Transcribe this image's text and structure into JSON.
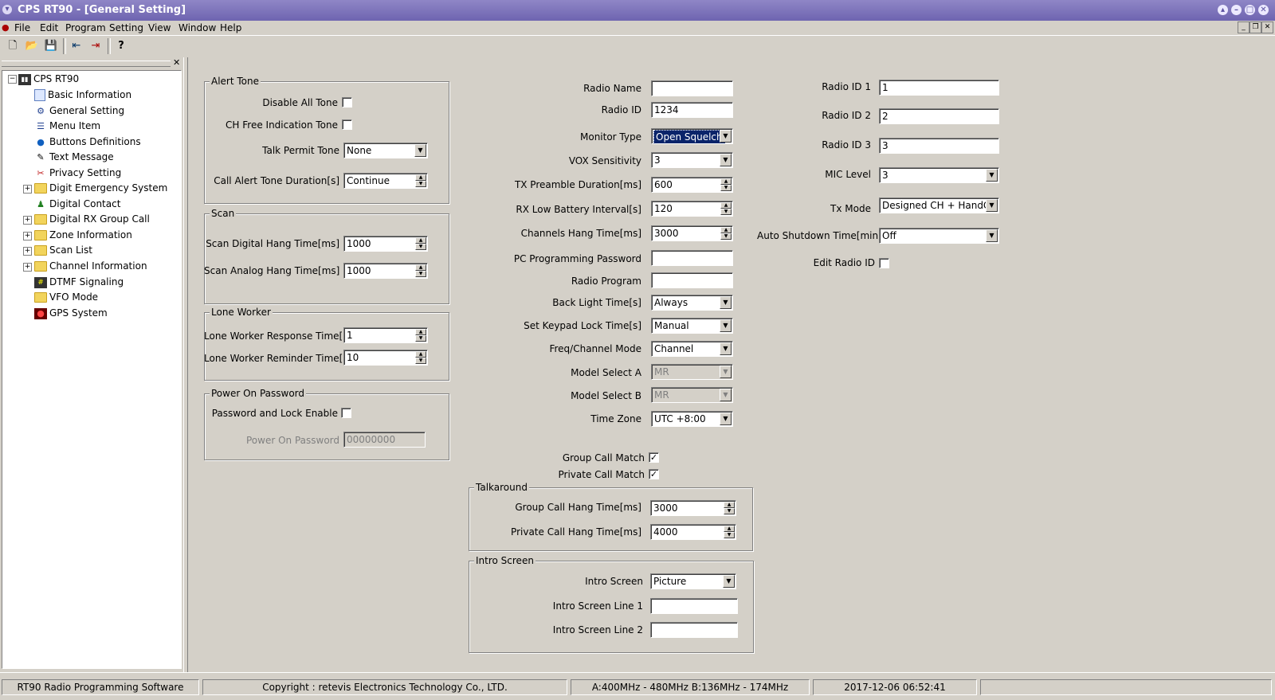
{
  "window": {
    "title": "CPS RT90 - [General Setting]"
  },
  "menu": [
    "File",
    "Edit",
    "Program",
    "Setting",
    "View",
    "Window",
    "Help"
  ],
  "tree": {
    "root": "CPS RT90",
    "items": [
      {
        "label": "Basic Information",
        "icon": "document-icon"
      },
      {
        "label": "General Setting",
        "icon": "gear-icon"
      },
      {
        "label": "Menu Item",
        "icon": "menu-icon"
      },
      {
        "label": "Buttons Definitions",
        "icon": "button-icon"
      },
      {
        "label": "Text Message",
        "icon": "message-icon"
      },
      {
        "label": "Privacy Setting",
        "icon": "privacy-icon"
      },
      {
        "label": "Digit Emergency System",
        "icon": "folder-icon"
      },
      {
        "label": "Digital Contact",
        "icon": "contact-icon"
      },
      {
        "label": "Digital RX Group Call",
        "icon": "folder-icon"
      },
      {
        "label": "Zone Information",
        "icon": "folder-icon"
      },
      {
        "label": "Scan List",
        "icon": "folder-icon"
      },
      {
        "label": "Channel Information",
        "icon": "folder-icon"
      },
      {
        "label": "DTMF Signaling",
        "icon": "dtmf-icon"
      },
      {
        "label": "VFO Mode",
        "icon": "folder-icon"
      },
      {
        "label": "GPS System",
        "icon": "gps-icon"
      }
    ]
  },
  "alert_tone": {
    "title": "Alert Tone",
    "disable_all_tone": "Disable All Tone",
    "ch_free_indication_tone": "CH Free Indication Tone",
    "talk_permit_tone_label": "Talk Permit Tone",
    "talk_permit_tone_value": "None",
    "call_alert_tone_duration_label": "Call Alert Tone Duration[s]",
    "call_alert_tone_duration_value": "Continue"
  },
  "scan": {
    "title": "Scan",
    "digital_hang_label": "Scan Digital Hang Time[ms]",
    "digital_hang_value": "1000",
    "analog_hang_label": "Scan Analog Hang Time[ms]",
    "analog_hang_value": "1000"
  },
  "lone_worker": {
    "title": "Lone Worker",
    "response_label": "Lone Worker Response Time[min]",
    "response_value": "1",
    "reminder_label": "Lone Worker Reminder Time[s]",
    "reminder_value": "10"
  },
  "power_on_password": {
    "title": "Power On Password",
    "enable_label": "Password and Lock Enable",
    "password_label": "Power On Password",
    "password_value": "00000000"
  },
  "middle": {
    "radio_name_label": "Radio Name",
    "radio_name_value": "",
    "radio_id_label": "Radio ID",
    "radio_id_value": "1234",
    "monitor_type_label": "Monitor Type",
    "monitor_type_value": "Open Squelch",
    "vox_label": "VOX Sensitivity",
    "vox_value": "3",
    "tx_preamble_label": "TX Preamble Duration[ms]",
    "tx_preamble_value": "600",
    "rx_low_batt_label": "RX Low Battery Interval[s]",
    "rx_low_batt_value": "120",
    "channels_hang_label": "Channels Hang Time[ms]",
    "channels_hang_value": "3000",
    "pc_prog_pw_label": "PC Programming Password",
    "pc_prog_pw_value": "",
    "radio_program_label": "Radio Program",
    "radio_program_value": "",
    "back_light_label": "Back Light Time[s]",
    "back_light_value": "Always",
    "keypad_lock_label": "Set Keypad Lock Time[s]",
    "keypad_lock_value": "Manual",
    "freq_channel_label": "Freq/Channel Mode",
    "freq_channel_value": "Channel",
    "model_a_label": "Model Select A",
    "model_a_value": "MR",
    "model_b_label": "Model Select B",
    "model_b_value": "MR",
    "time_zone_label": "Time Zone",
    "time_zone_value": "UTC +8:00",
    "group_call_match_label": "Group Call Match",
    "private_call_match_label": "Private Call Match"
  },
  "talkaround": {
    "title": "Talkaround",
    "group_hang_label": "Group Call Hang Time[ms]",
    "group_hang_value": "3000",
    "private_hang_label": "Private Call Hang Time[ms]",
    "private_hang_value": "4000"
  },
  "intro_screen": {
    "title": "Intro Screen",
    "intro_label": "Intro Screen",
    "intro_value": "Picture",
    "line1_label": "Intro Screen Line 1",
    "line1_value": "",
    "line2_label": "Intro Screen Line 2",
    "line2_value": ""
  },
  "right": {
    "radio_id1_label": "Radio ID 1",
    "radio_id1_value": "1",
    "radio_id2_label": "Radio ID 2",
    "radio_id2_value": "2",
    "radio_id3_label": "Radio ID 3",
    "radio_id3_value": "3",
    "mic_level_label": "MIC Level",
    "mic_level_value": "3",
    "tx_mode_label": "Tx Mode",
    "tx_mode_value": "Designed CH + HandCH",
    "auto_shutdown_label": "Auto Shutdown Time[min]",
    "auto_shutdown_value": "Off",
    "edit_radio_id_label": "Edit Radio ID"
  },
  "checkboxes": {
    "disable_all_tone": false,
    "ch_free_indication_tone": false,
    "password_and_lock_enable": false,
    "group_call_match": true,
    "private_call_match": true,
    "edit_radio_id": false
  },
  "statusbar": {
    "app": "RT90 Radio Programming Software",
    "copyright": "Copyright : retevis  Electronics Technology Co., LTD.",
    "bands": "A:400MHz - 480MHz B:136MHz - 174MHz",
    "datetime": "2017-12-06 06:52:41"
  }
}
